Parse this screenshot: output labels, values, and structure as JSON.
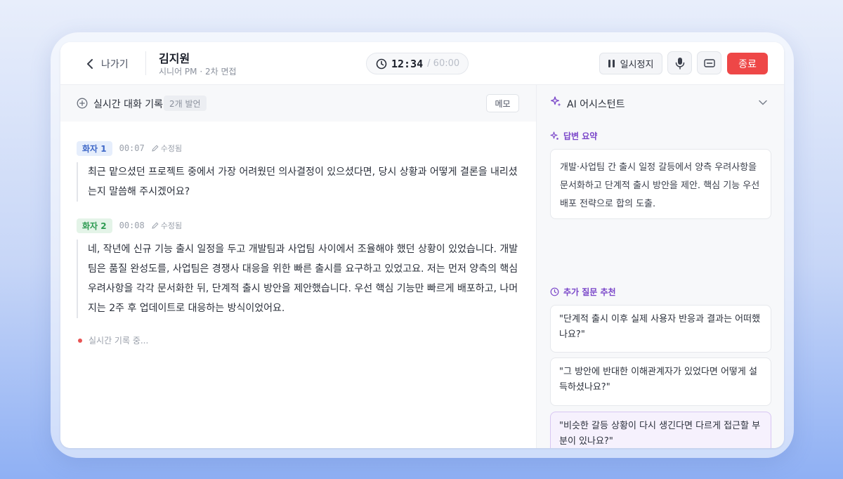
{
  "header": {
    "back_label": "나가기",
    "candidate_name": "김지원",
    "candidate_sub": "시니어 PM · 2차 면접",
    "timer_current": "12:34",
    "timer_total": "/ 60:00",
    "pause_label": "일시정지",
    "end_label": "종료"
  },
  "transcript": {
    "title": "실시간 대화 기록",
    "count": "2개 발언",
    "memo_label": "메모",
    "utterances": [
      {
        "speaker": "화자 1",
        "time": "00:07",
        "edited": "수정됨",
        "text": "최근 맡으셨던 프로젝트 중에서 가장 어려웠던 의사결정이 있으셨다면, 당시 상황과 어떻게 결론을 내리셨는지 말씀해 주시겠어요?"
      },
      {
        "speaker": "화자 2",
        "time": "00:08",
        "edited": "수정됨",
        "text": "네, 작년에 신규 기능 출시 일정을 두고 개발팀과 사업팀 사이에서 조율해야 했던 상황이 있었습니다. 개발팀은 품질 완성도를, 사업팀은 경쟁사 대응을 위한 빠른 출시를 요구하고 있었고요. 저는 먼저 양측의 핵심 우려사항을 각각 문서화한 뒤, 단계적 출시 방안을 제안했습니다. 우선 핵심 기능만 빠르게 배포하고, 나머지는 2주 후 업데이트로 대응하는 방식이었어요."
      }
    ],
    "recording_label": "실시간 기록 중..."
  },
  "assistant": {
    "title": "AI 어시스턴트",
    "summary_label": "답변 요약",
    "summary_text": "개발·사업팀 간 출시 일정 갈등에서 양측 우려사항을 문서화하고 단계적 출시 방안을 제안. 핵심 기능 우선 배포 전략으로 합의 도출.",
    "followup_label": "추가 질문 추천",
    "questions": [
      "\"단계적 출시 이후 실제 사용자 반응과 결과는 어떠했나요?\"",
      "\"그 방안에 반대한 이해관계자가 있었다면 어떻게 설득하셨나요?\"",
      "\"비슷한 갈등 상황이 다시 생긴다면 다르게 접근할 부분이 있나요?\""
    ]
  },
  "colors": {
    "accent_purple": "#7a46c9",
    "end_red": "#ee4747",
    "speaker1_blue": "#3f68c8",
    "speaker2_green": "#2e9b52"
  }
}
